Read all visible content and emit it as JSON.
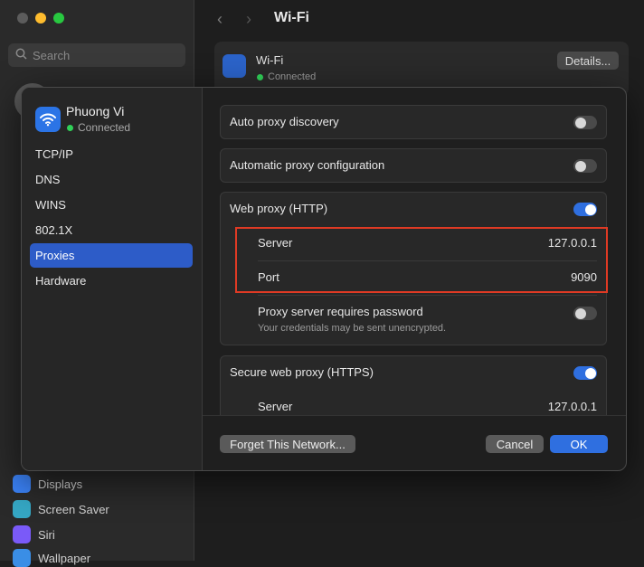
{
  "window": {
    "title": "Wi-Fi",
    "search_placeholder": "Search"
  },
  "bg_sidebar_items": [
    {
      "label": "Displays",
      "color": "#3b82f6"
    },
    {
      "label": "Screen Saver",
      "color": "#35a7c4"
    },
    {
      "label": "Siri",
      "color": "#7a5af8"
    },
    {
      "label": "Wallpaper",
      "color": "#3a8ee6"
    }
  ],
  "bg_wifi": {
    "name": "Wi-Fi",
    "status": "Connected",
    "details_label": "Details..."
  },
  "sheet": {
    "network_name": "Phuong Vi",
    "network_status": "Connected",
    "sidebar": [
      {
        "label": "TCP/IP",
        "active": false
      },
      {
        "label": "DNS",
        "active": false
      },
      {
        "label": "WINS",
        "active": false
      },
      {
        "label": "802.1X",
        "active": false
      },
      {
        "label": "Proxies",
        "active": true
      },
      {
        "label": "Hardware",
        "active": false
      }
    ],
    "auto_proxy_discovery": {
      "label": "Auto proxy discovery",
      "on": false
    },
    "auto_proxy_config": {
      "label": "Automatic proxy configuration",
      "on": false
    },
    "web_proxy": {
      "label": "Web proxy (HTTP)",
      "on": true,
      "server_label": "Server",
      "server_value": "127.0.0.1",
      "port_label": "Port",
      "port_value": "9090",
      "password_label": "Proxy server requires password",
      "password_note": "Your credentials may be sent unencrypted.",
      "password_on": false
    },
    "secure_proxy": {
      "label": "Secure web proxy (HTTPS)",
      "on": true,
      "server_label": "Server",
      "server_value": "127.0.0.1"
    },
    "buttons": {
      "forget": "Forget This Network...",
      "cancel": "Cancel",
      "ok": "OK"
    }
  },
  "colors": {
    "accent": "#2f6fe0",
    "highlight": "#e03a24",
    "connected": "#30d158"
  }
}
